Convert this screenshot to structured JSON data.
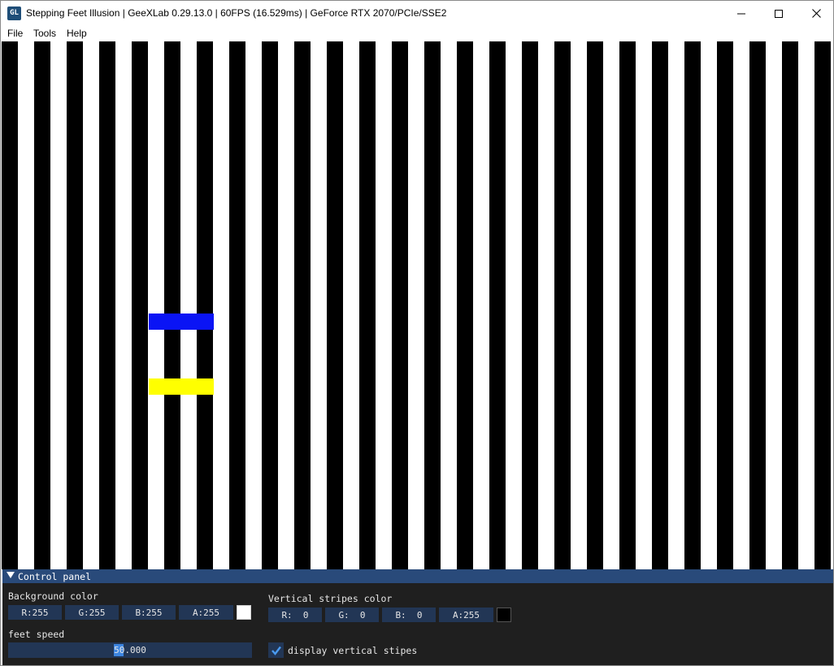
{
  "window": {
    "title": "Stepping Feet Illusion | GeeXLab 0.29.13.0 | 60FPS (16.529ms) | GeForce RTX 2070/PCIe/SSE2",
    "icon": "geexlab-logo-icon",
    "controls": [
      "minimize-icon",
      "maximize-icon",
      "close-icon"
    ]
  },
  "menu": {
    "file": "File",
    "tools": "Tools",
    "help": "Help"
  },
  "scene": {
    "stripe_color": "#000000",
    "background_color": "#ffffff",
    "feet": [
      {
        "name": "blue-foot",
        "color": "#0a14f5"
      },
      {
        "name": "yellow-foot",
        "color": "#ffff00"
      }
    ]
  },
  "control_panel": {
    "title": "Control panel",
    "collapse_icon": "triangle-down-icon",
    "background_color": {
      "label": "Background color",
      "r": "R:255",
      "g": "G:255",
      "b": "B:255",
      "a": "A:255",
      "swatch": "#ffffff"
    },
    "vertical_stripes_color": {
      "label": "Vertical stripes color",
      "r": "R:  0",
      "g": "G:  0",
      "b": "B:  0",
      "a": "A:255",
      "swatch": "#000000"
    },
    "feet_speed": {
      "label": "feet speed",
      "value": "50.000"
    },
    "display_stripes": {
      "label": "display vertical stipes",
      "checked": true
    }
  }
}
